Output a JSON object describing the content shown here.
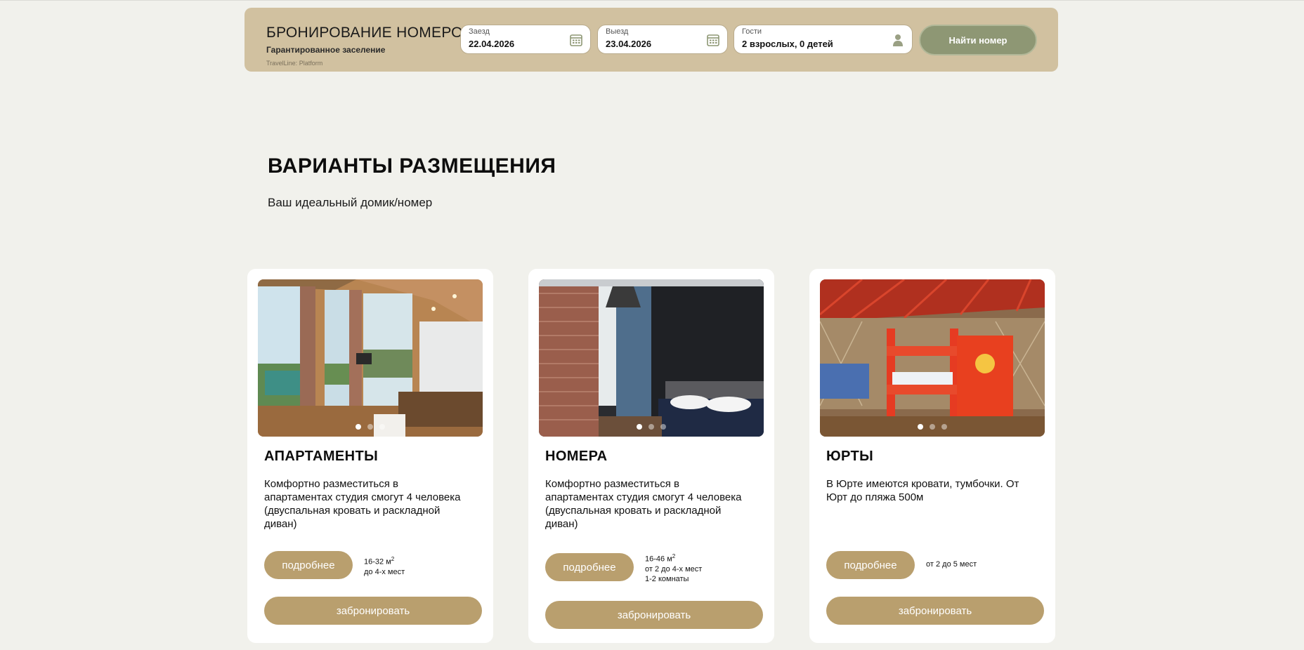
{
  "booking": {
    "title": "БРОНИРОВАНИЕ НОМЕРОВ",
    "subtitle": "Гарантированное заселение",
    "brand": "TravelLine: Platform",
    "checkin_label": "Заезд",
    "checkin_value": "22.04.2026",
    "checkout_label": "Выезд",
    "checkout_value": "23.04.2026",
    "guests_label": "Гости",
    "guests_value": "2 взрослых, 0 детей",
    "find_button": "Найти номер",
    "icons": {
      "checkin": "calendar-icon",
      "checkout": "calendar-icon",
      "guests": "person-icon"
    }
  },
  "section": {
    "title": "ВАРИАНТЫ РАЗМЕЩЕНИЯ",
    "subtitle": "Ваш идеальный домик/номер"
  },
  "cards": [
    {
      "title": "АПАРТАМЕНТЫ",
      "description": "Комфортно разместиться в апартаментах студия смогут 4 человека (двуспальная кровать и раскладной диван)",
      "more_button": "подробнее",
      "area": "16-32 м",
      "area_unit_sup": "2",
      "info": [
        "до 4-х мест"
      ],
      "book_button": "забронировать",
      "slides": 3,
      "active_slide": 1
    },
    {
      "title": "НОМЕРА",
      "description": "Комфортно разместиться в апартаментах студия смогут 4 человека (двуспальная кровать и раскладной диван)",
      "more_button": "подробнее",
      "area": "16-46 м",
      "area_unit_sup": "2",
      "info": [
        "от 2 до 4-х мест",
        "1-2 комнаты"
      ],
      "book_button": "забронировать",
      "slides": 3,
      "active_slide": 1
    },
    {
      "title": "ЮРТЫ",
      "description": "В Юрте имеются кровати, тумбочки. От Юрт до пляжа 500м",
      "more_button": "подробнее",
      "info": [
        "от 2 до 5 мест"
      ],
      "book_button": "забронировать",
      "slides": 3,
      "active_slide": 1
    }
  ],
  "colors": {
    "page_bg": "#f1f1ec",
    "booking_bg": "#d1c1a0",
    "find_button": "#8e9774",
    "accent_button": "#b99f6e"
  }
}
